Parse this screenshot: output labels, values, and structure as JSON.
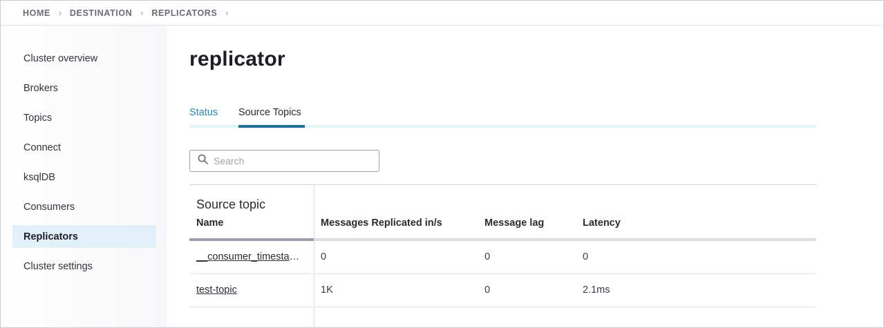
{
  "breadcrumb": {
    "items": [
      "HOME",
      "DESTINATION",
      "REPLICATORS"
    ]
  },
  "sidebar": {
    "items": [
      {
        "label": "Cluster overview"
      },
      {
        "label": "Brokers"
      },
      {
        "label": "Topics"
      },
      {
        "label": "Connect"
      },
      {
        "label": "ksqlDB"
      },
      {
        "label": "Consumers"
      },
      {
        "label": "Replicators",
        "active": true
      },
      {
        "label": "Cluster settings"
      }
    ]
  },
  "main": {
    "title": "replicator",
    "tabs": [
      {
        "label": "Status"
      },
      {
        "label": "Source Topics",
        "active": true
      }
    ],
    "search": {
      "placeholder": "Search",
      "value": ""
    },
    "table": {
      "group_header": "Source topic",
      "columns": [
        "Name",
        "Messages Replicated in/s",
        "Message lag",
        "Latency"
      ],
      "rows": [
        {
          "name": "__consumer_timestamps",
          "replicated": "0",
          "lag": "0",
          "latency": "0"
        },
        {
          "name": "test-topic",
          "replicated": "1K",
          "lag": "0",
          "latency": "2.1ms"
        }
      ]
    }
  },
  "colors": {
    "accent": "#2a86ba",
    "tab_active_underline": "#1f6f97",
    "active_nav_bg": "#e2f0f9"
  },
  "icons": {
    "search": "search-icon",
    "breadcrumb_separator": "chevron-right-icon"
  }
}
